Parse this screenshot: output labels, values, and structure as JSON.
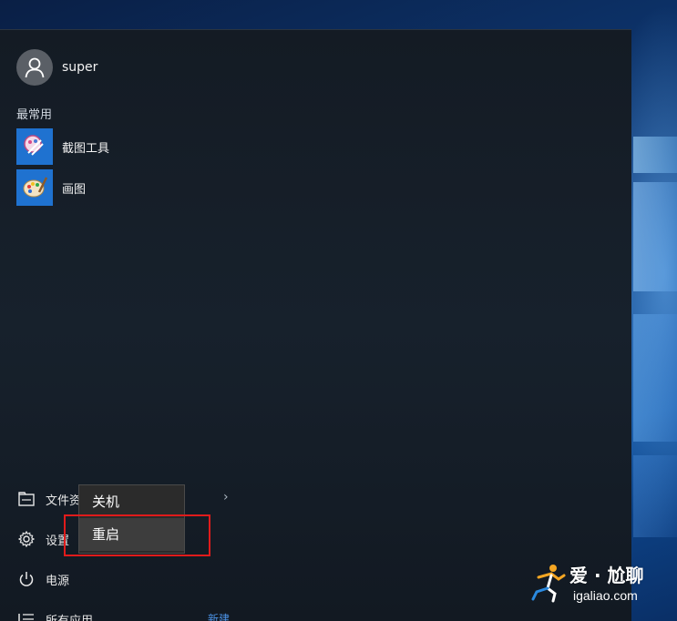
{
  "user": {
    "name": "super"
  },
  "most_used": {
    "label": "最常用",
    "apps": [
      {
        "label": "截图工具",
        "icon": "snipping-tool-icon"
      },
      {
        "label": "画图",
        "icon": "paint-icon"
      }
    ]
  },
  "bottom": {
    "explorer_label": "文件资源管理器",
    "settings_label": "设置",
    "power_label": "电源",
    "allapps_label": "所有应用",
    "new_badge": "新建"
  },
  "power_menu": {
    "items": [
      {
        "label": "关机"
      },
      {
        "label": "重启"
      }
    ]
  },
  "watermark": {
    "title": "爱 · 尬聊",
    "url": "igaliao.com"
  },
  "colors": {
    "accent": "#1f72d0",
    "highlight": "#e01b1b",
    "menu_bg": "#2b2b2b"
  }
}
